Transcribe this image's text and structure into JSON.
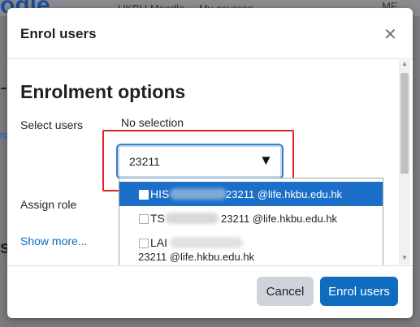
{
  "background": {
    "logo": "odle",
    "nav": [
      "HKBU Moodle",
      "My courses"
    ],
    "right": "MF",
    "dash": "-",
    "link": "ng",
    "s": "s"
  },
  "modal": {
    "title": "Enrol users",
    "section_title": "Enrolment options",
    "select_users_label": "Select users",
    "no_selection": "No selection",
    "search_value": "23211",
    "assign_role_label": "Assign role",
    "show_more": "Show more...",
    "dropdown_options": [
      {
        "name": "HIS",
        "email": "23211 @life.hkbu.edu.hk"
      },
      {
        "name": "TS",
        "email": "23211 @life.hkbu.edu.hk"
      },
      {
        "name": "LAI",
        "email": ""
      }
    ],
    "extra_email": "23211 @life.hkbu.edu.hk",
    "cancel_label": "Cancel",
    "enrol_label": "Enrol users"
  }
}
